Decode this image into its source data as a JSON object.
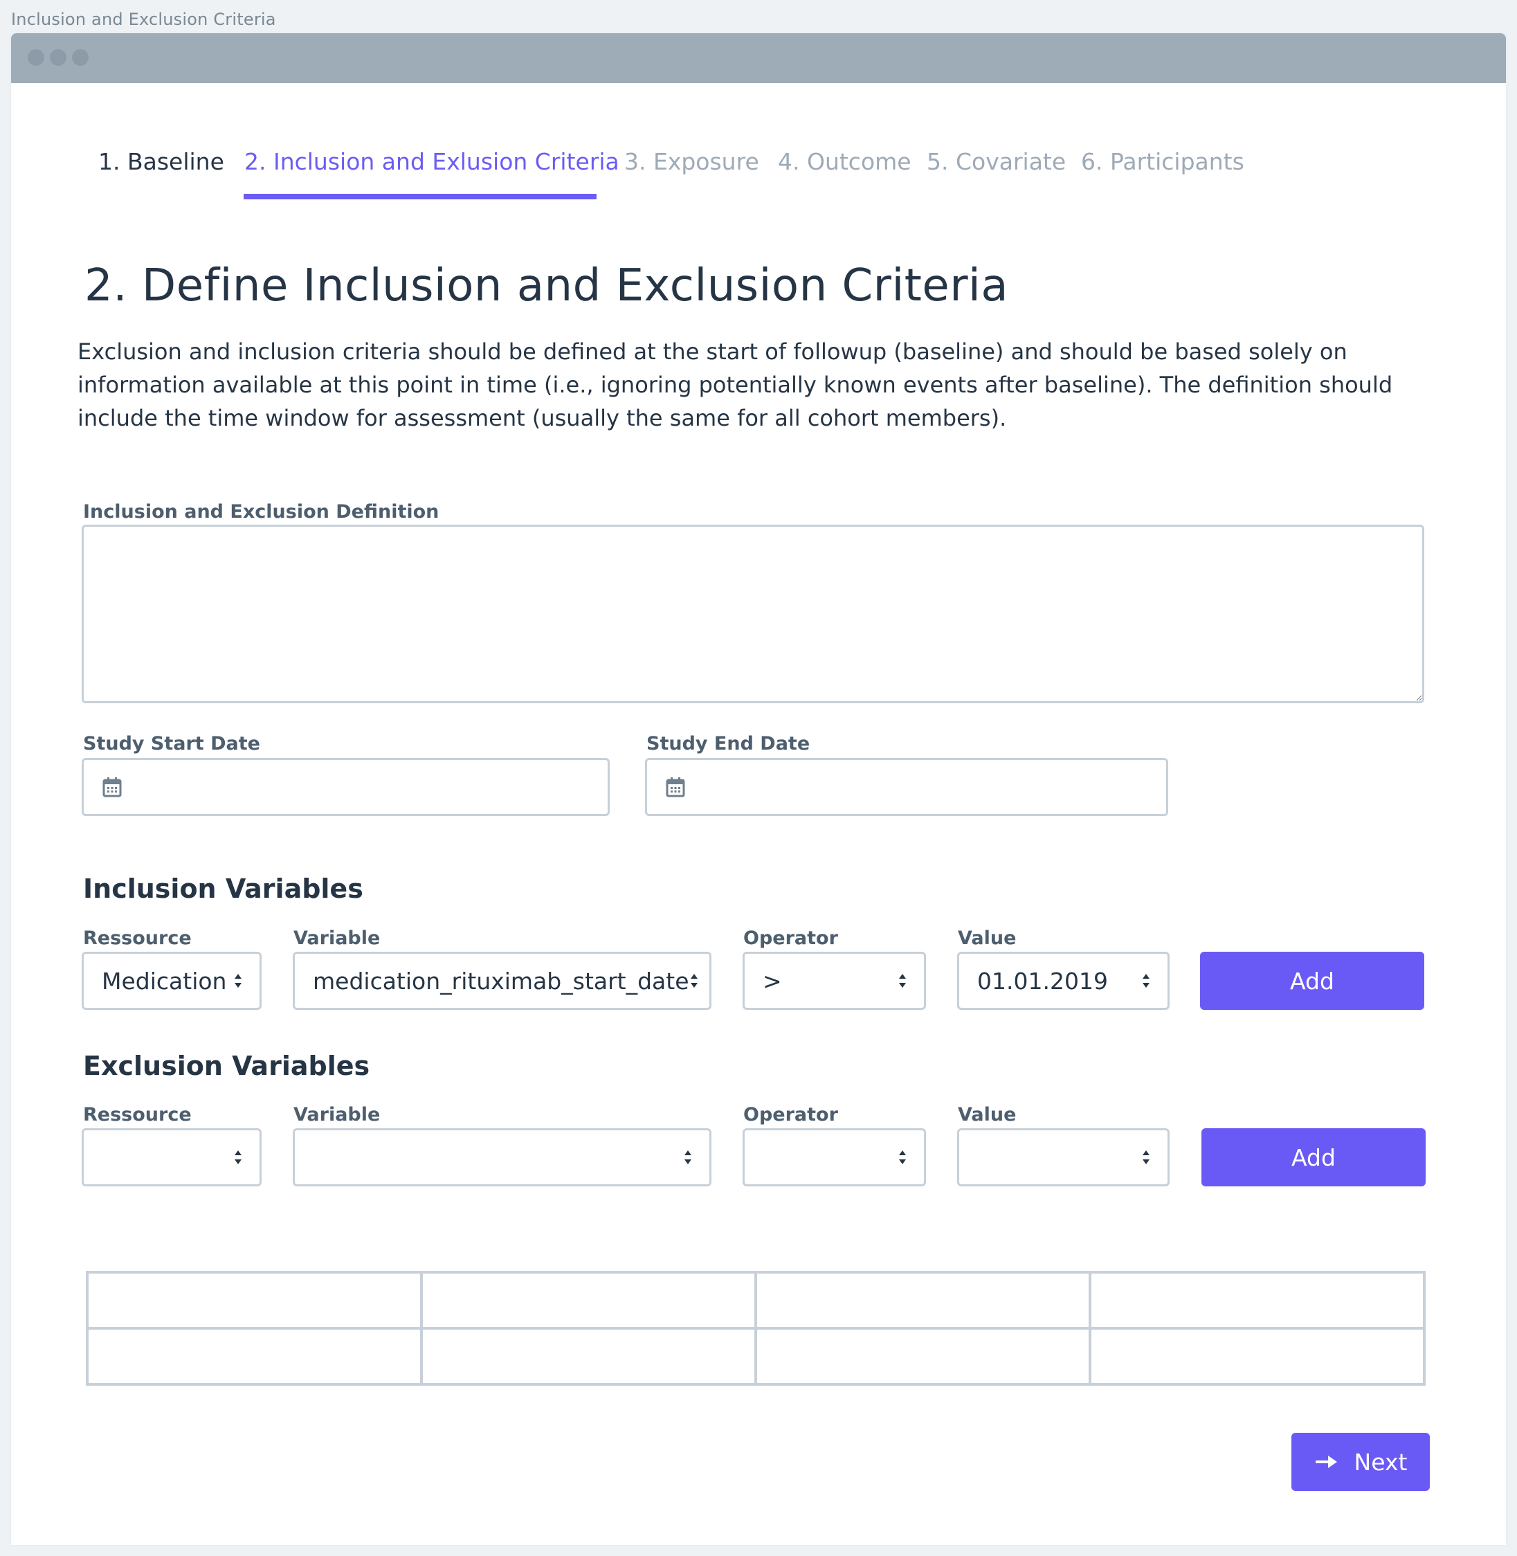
{
  "page_title": "Inclusion and Exclusion Criteria",
  "colors": {
    "accent": "#6a5af5",
    "titlebar": "#9eacb8",
    "border": "#c7d0d9",
    "text_dark": "#263545",
    "tab_inactive": "#9eaab6"
  },
  "tabs": [
    {
      "label": "1. Baseline",
      "state": "done"
    },
    {
      "label": "2. Inclusion and Exlusion Criteria",
      "state": "active"
    },
    {
      "label": "3. Exposure",
      "state": "inactive"
    },
    {
      "label": "4. Outcome",
      "state": "inactive"
    },
    {
      "label": "5. Covariate",
      "state": "inactive"
    },
    {
      "label": "6. Participants",
      "state": "inactive"
    }
  ],
  "main": {
    "heading": "2. Define Inclusion and Exclusion Criteria",
    "intro": "Exclusion and inclusion criteria should be defined at the start of followup (baseline) and should be based solely on information available at this point in time (i.e., ignoring potentially known events after baseline). The definition should include the time window for assessment (usually the same for all cohort members).",
    "definition": {
      "label": "Inclusion and Exclusion Definition",
      "value": ""
    },
    "start_date": {
      "label": "Study Start Date",
      "value": "",
      "icon": "calendar-icon"
    },
    "end_date": {
      "label": "Study End Date",
      "value": "",
      "icon": "calendar-icon"
    }
  },
  "inclusion": {
    "title": "Inclusion Variables",
    "labels": {
      "resource": "Ressource",
      "variable": "Variable",
      "operator": "Operator",
      "value": "Value"
    },
    "values": {
      "resource": "Medication",
      "variable": "medication_rituximab_start_date",
      "operator": ">",
      "value": "01.01.2019"
    },
    "add_label": "Add"
  },
  "exclusion": {
    "title": "Exclusion Variables",
    "labels": {
      "resource": "Ressource",
      "variable": "Variable",
      "operator": "Operator",
      "value": "Value"
    },
    "values": {
      "resource": "",
      "variable": "",
      "operator": "",
      "value": ""
    },
    "add_label": "Add"
  },
  "criteria_table": {
    "rows": [
      [
        "",
        "",
        "",
        ""
      ],
      [
        "",
        "",
        "",
        ""
      ]
    ]
  },
  "footer": {
    "next_label": "Next",
    "next_icon": "arrow-right-icon"
  }
}
